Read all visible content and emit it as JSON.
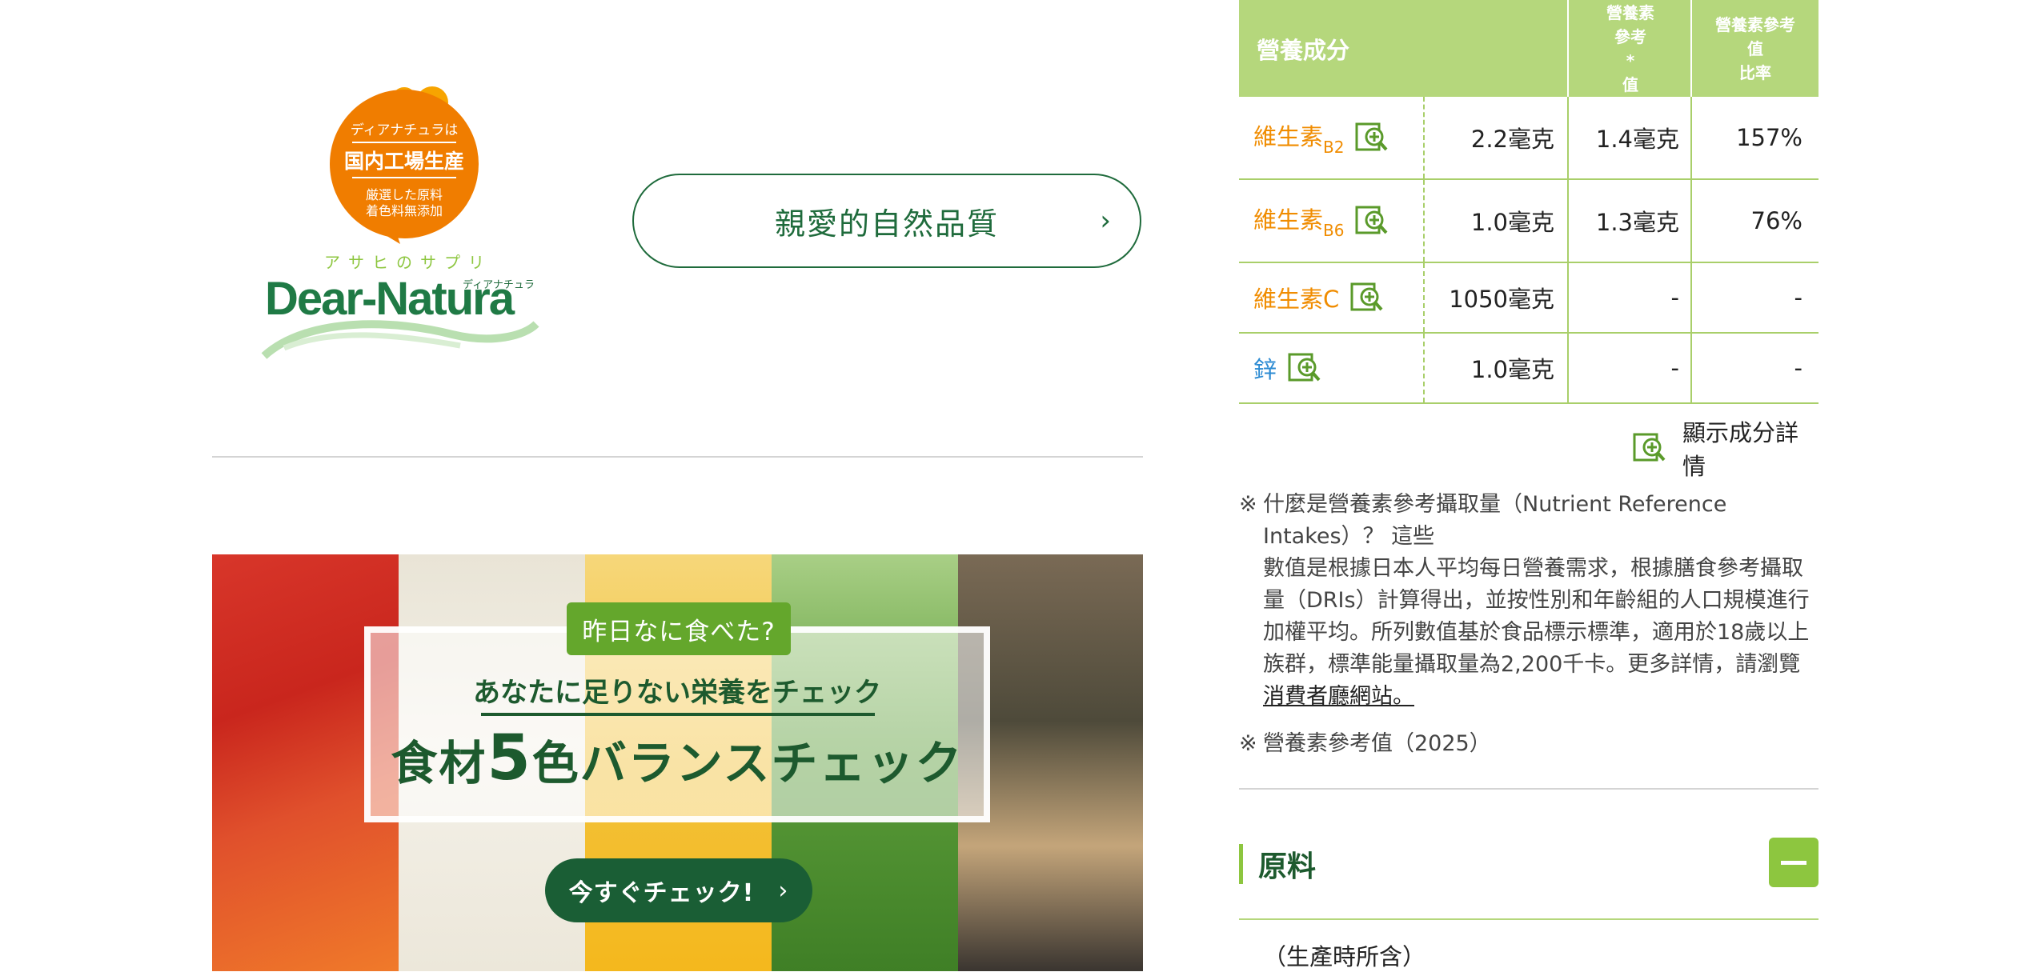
{
  "logo": {
    "badge_line1": "ディアナチュラは",
    "badge_line2": "国内工場生産",
    "badge_line3": "厳選した原料",
    "badge_line4": "着色料無添加",
    "tagline": "アサヒのサプリ",
    "brand": "Dear-Natura",
    "brand_kana": "ディアナチュラ"
  },
  "brand_button": {
    "label": "親愛的自然品質"
  },
  "banner": {
    "pill": "昨日なに食べた?",
    "subtitle": "あなたに足りない栄養をチェック",
    "title_pre": "食材",
    "title_num": "5",
    "title_post": "色バランスチェック",
    "cta": "今すぐチェック!"
  },
  "nutrition_table": {
    "headers": {
      "nutrient": "營養成分",
      "ref_value": "營養素\n參考\n*\n值",
      "ratio": "營養素參考\n值\n比率"
    },
    "rows": [
      {
        "name": "維生素",
        "sub": "B2",
        "amount": "2.2毫克",
        "ref": "1.4毫克",
        "ratio": "157%"
      },
      {
        "name": "維生素",
        "sub": "B6",
        "amount": "1.0毫克",
        "ref": "1.3毫克",
        "ratio": "76%"
      },
      {
        "name": "維生素C",
        "sub": "",
        "amount": "1050毫克",
        "ref": "-",
        "ratio": "-"
      },
      {
        "name": "鋅",
        "sub": "",
        "amount": "1.0毫克",
        "ref": "-",
        "ratio": "-"
      }
    ]
  },
  "detail_link": {
    "label": "顯示成分詳情"
  },
  "notes": {
    "mark": "※",
    "note1_line1": "什麼是營養素參考攝取量（Nutrient Reference",
    "note1_line2": "Intakes）？ 這些",
    "note1_body": "數值是根據日本人平均每日營養需求，根據膳食參考攝取量（DRIs）計算得出，並按性別和年齡組的人口規模進行加權平均。所列數值基於食品標示標準，適用於18歲以上族群，標準能量攝取量為2,200千卡。更多詳情，請瀏覽",
    "note1_link": "消費者廳網站。",
    "note2": "營養素參考值（2025）"
  },
  "ingredients": {
    "title": "原料",
    "content": "（生產時所含）"
  },
  "colors": {
    "brand_green": "#1f6b3c",
    "header_green": "#b5d77c",
    "accent_green": "#8dc63f",
    "orange": "#f08c00",
    "blue": "#2c8bd3"
  }
}
